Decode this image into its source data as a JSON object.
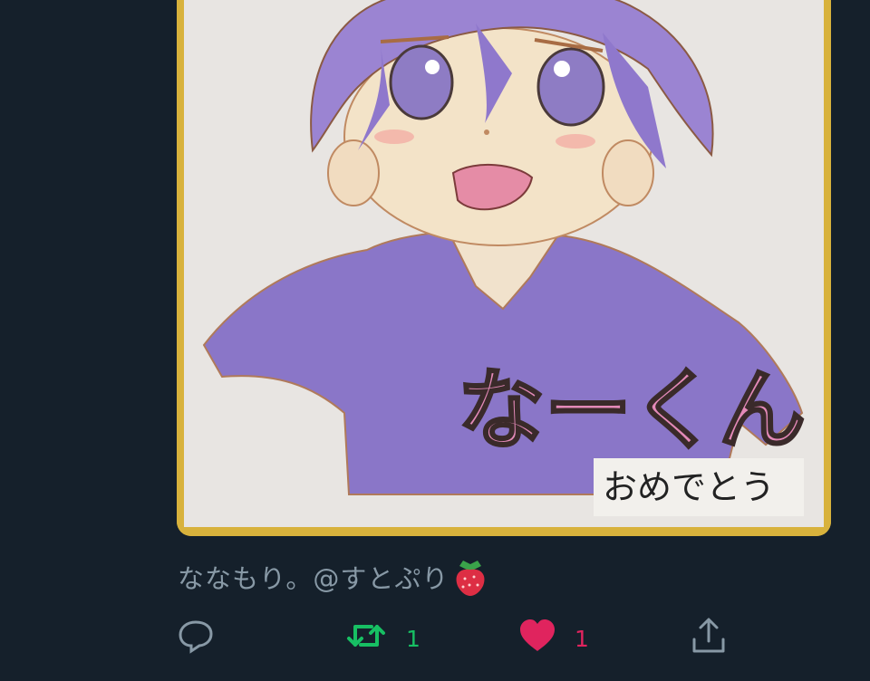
{
  "tweet": {
    "image": {
      "artwork_text": {
        "main": "なーくん",
        "sub": "おめでとう"
      },
      "colors": {
        "frame": "#d9b441",
        "paper": "#e7e4e1",
        "hair": "#9b84d2",
        "hoodie": "#8c77c9"
      }
    },
    "mention_text": "ななもり。@すとぷり",
    "mention_emoji": "strawberry-icon",
    "actions": {
      "reply": {
        "icon": "reply-icon"
      },
      "retweet": {
        "icon": "retweet-icon",
        "count": "1",
        "color": "#17bf63"
      },
      "like": {
        "icon": "heart-icon",
        "count": "1",
        "color": "#e0245e"
      },
      "share": {
        "icon": "share-icon"
      }
    }
  },
  "theme": {
    "background": "#15202b",
    "muted_text": "#8899a6"
  }
}
